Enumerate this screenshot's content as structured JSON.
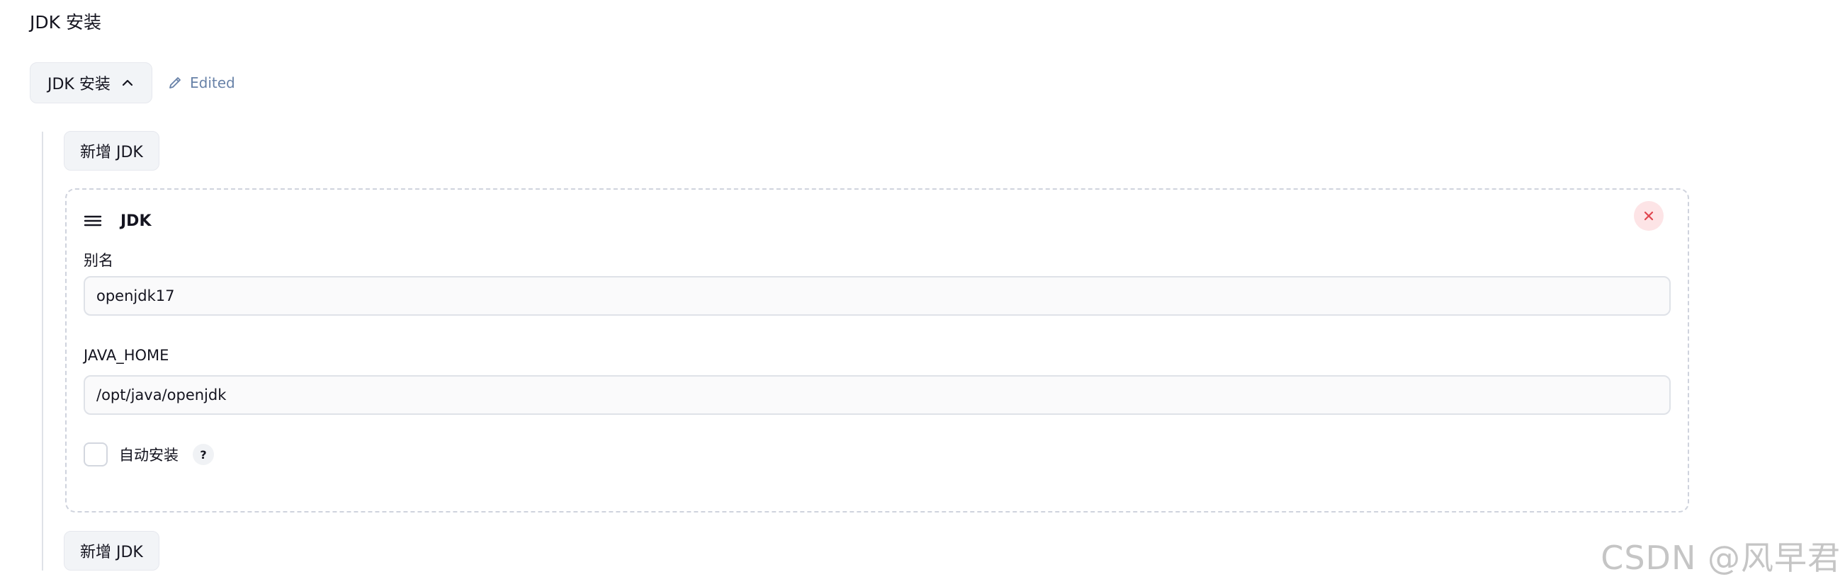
{
  "section": {
    "title": "JDK 安装"
  },
  "toggle": {
    "label": "JDK 安装",
    "icon": "chevron-up-icon"
  },
  "status": {
    "label": "Edited",
    "icon": "pencil-icon",
    "color": "#6882a8"
  },
  "add_button": {
    "label": "新增 JDK"
  },
  "jdk_card": {
    "title": "JDK",
    "fields": [
      {
        "label": "别名",
        "value": "openjdk17"
      },
      {
        "label": "JAVA_HOME",
        "value": "/opt/java/openjdk"
      }
    ],
    "auto_install": {
      "label": "自动安装",
      "checked": false,
      "help": "?"
    },
    "close_icon": "close-icon",
    "close_color": "#e0464f"
  },
  "watermark": {
    "text": "CSDN @风早君"
  }
}
